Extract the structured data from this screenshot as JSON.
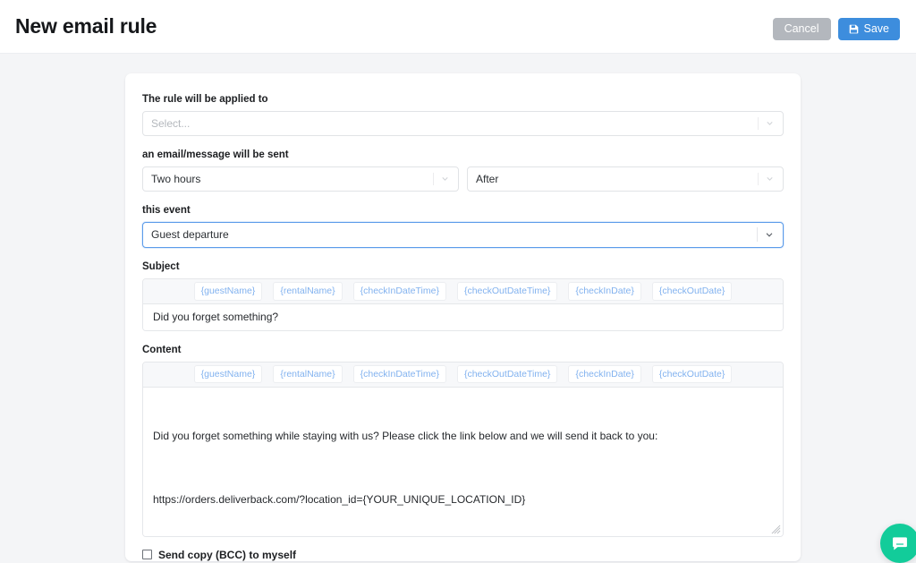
{
  "header": {
    "title": "New email rule",
    "cancel_label": "Cancel",
    "save_label": "Save"
  },
  "form": {
    "applied_to": {
      "label": "The rule will be applied to",
      "value": "",
      "placeholder": "Select..."
    },
    "timing": {
      "label": "an email/message will be sent",
      "offset_value": "Two hours",
      "direction_value": "After"
    },
    "event": {
      "label": "this event",
      "value": "Guest departure"
    },
    "subject": {
      "label": "Subject",
      "value": "Did you forget something?"
    },
    "content": {
      "label": "Content",
      "line1": "Did you forget something while staying with us? Please click the link below and we will send it back to you:",
      "line2": "https://orders.deliverback.com/?location_id={YOUR_UNIQUE_LOCATION_ID}"
    },
    "bcc": {
      "label": "Send copy (BCC) to myself",
      "checked": false
    },
    "tokens": [
      "{guestName}",
      "{rentalName}",
      "{checkInDateTime}",
      "{checkOutDateTime}",
      "{checkInDate}",
      "{checkOutDate}"
    ]
  },
  "chat": {
    "icon": "chat-bubble-icon"
  },
  "colors": {
    "page_background": "#f4f5f7",
    "primary": "#3d8ddd",
    "cancel": "#b3b7bd",
    "token_text": "#82b2ef",
    "focus_border": "#5b9bea",
    "chat_accent": "#12cc9a"
  }
}
